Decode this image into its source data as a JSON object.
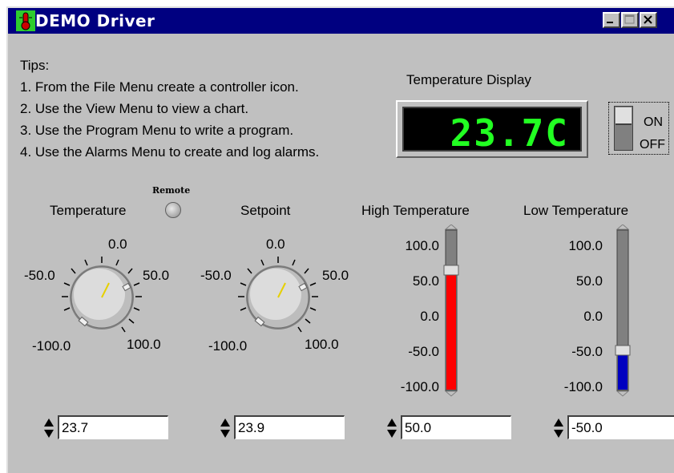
{
  "window": {
    "title": "DEMO Driver"
  },
  "tips": {
    "heading": "Tips:",
    "items": [
      "1. From the File Menu create a controller icon.",
      "2. Use the View Menu to view a chart.",
      "3. Use the Program Menu to write a program.",
      "4. Use the Alarms Menu to create and log alarms."
    ]
  },
  "display": {
    "label": "Temperature Display",
    "value": "23.7C"
  },
  "power_switch": {
    "on_label": "ON",
    "off_label": "OFF",
    "state": "off"
  },
  "remote": {
    "label": "Remote"
  },
  "temperature_knob": {
    "label": "Temperature",
    "scale": {
      "top": "0.0",
      "left": "-50.0",
      "right": "50.0",
      "bottom_left": "-100.0",
      "bottom_right": "100.0"
    },
    "value": "23.7"
  },
  "setpoint_knob": {
    "label": "Setpoint",
    "scale": {
      "top": "0.0",
      "left": "-50.0",
      "right": "50.0",
      "bottom_left": "-100.0",
      "bottom_right": "100.0"
    },
    "value": "23.9"
  },
  "high_slider": {
    "label": "High Temperature",
    "scale": [
      "100.0",
      "50.0",
      "0.0",
      "-50.0",
      "-100.0"
    ],
    "value": "50.0",
    "fill_color": "#ff0000"
  },
  "low_slider": {
    "label": "Low Temperature",
    "scale": [
      "100.0",
      "50.0",
      "0.0",
      "-50.0",
      "-100.0"
    ],
    "value": "-50.0",
    "fill_color": "#0000c0"
  }
}
